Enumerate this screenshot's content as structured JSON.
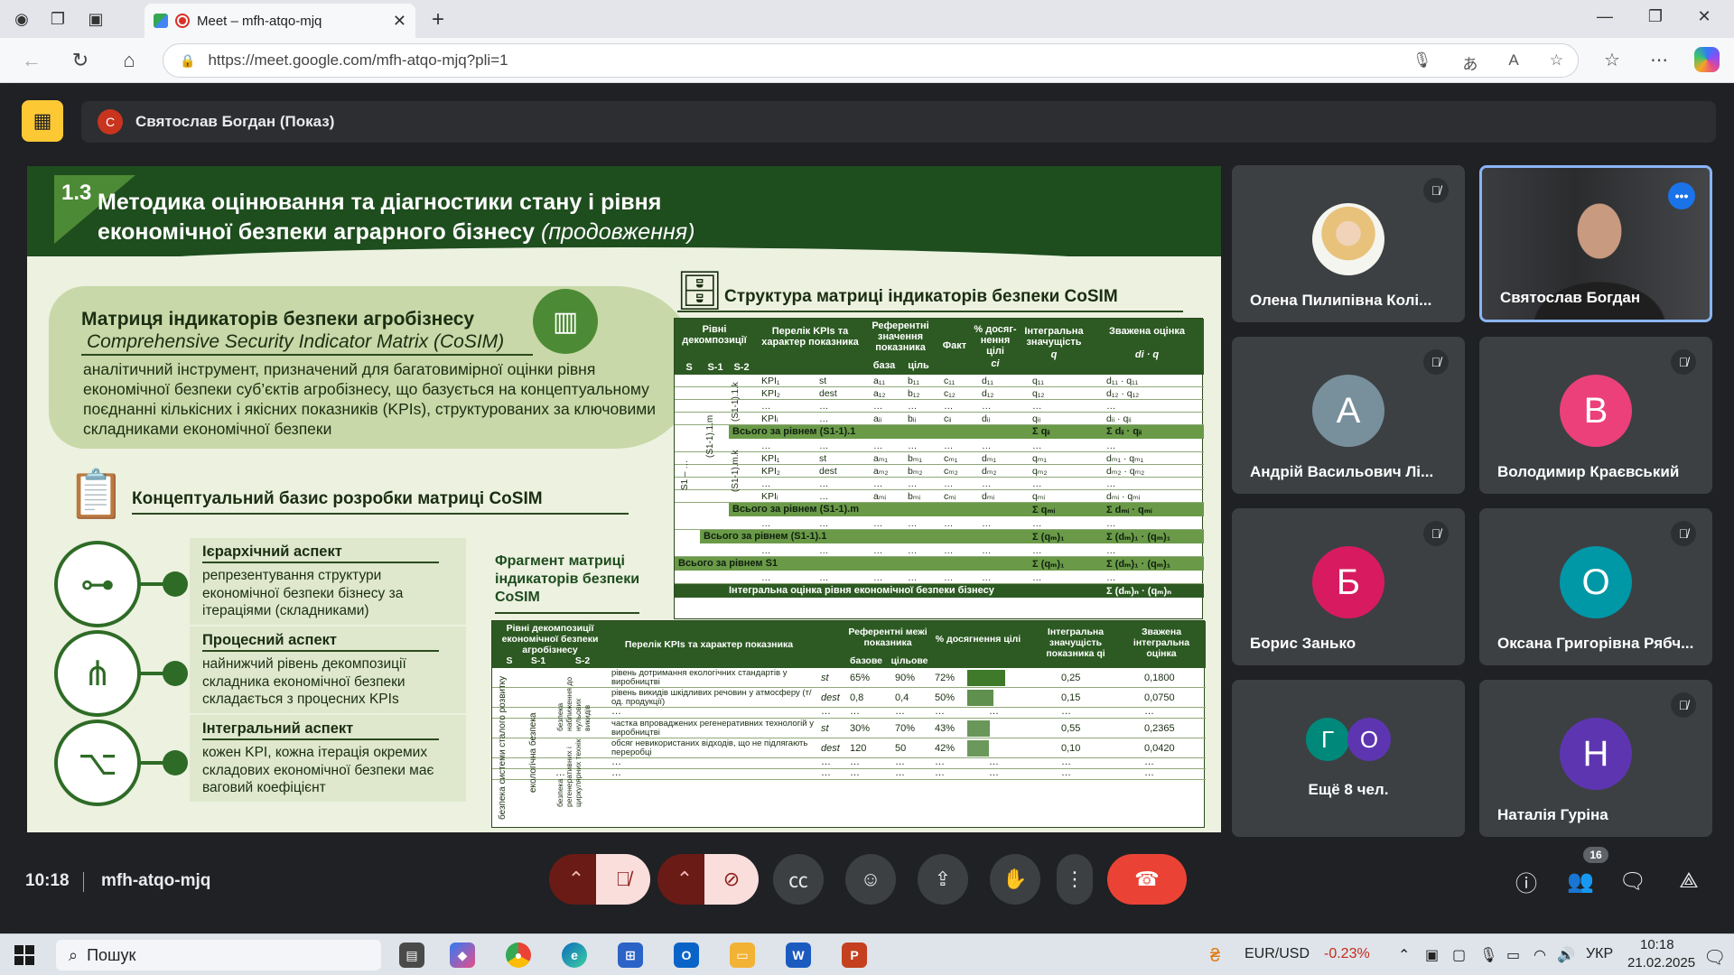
{
  "browser": {
    "tab_title": "Meet – mfh-atqo-mjq",
    "url": "https://meet.google.com/mfh-atqo-mjq?pli=1"
  },
  "meet": {
    "presenter_initial": "С",
    "presenter_label": "Святослав Богдан (Показ)",
    "time": "10:18",
    "code": "mfh-atqo-mjq",
    "participant_count": "16"
  },
  "slide": {
    "num": "1.3",
    "title_main": "Методика оцінювання та діагностики стану і рівня економічної безпеки аграрного бізнесу",
    "title_suffix": "(продовження)",
    "def_title": "Матриця індикаторів безпеки агробізнесу",
    "def_subtitle": "Comprehensive Security Indicator Matrix (CoSIM)",
    "def_body": "аналітичний інструмент, призначений для багатовимірної оцінки рівня економічної безпеки суб’єктів агробізнесу, що базується на концептуальному поєднанні кількісних і якісних показників (KPIs), структурованих за ключовими складниками економічної безпеки",
    "cb_title": "Концептуальний базис розробки матриці CoSIM",
    "aspects": [
      {
        "title": "Ієрархічний аспект",
        "body": "репрезентування структури економічної безпеки бізнесу за ітераціями (складниками)"
      },
      {
        "title": "Процесний аспект",
        "body": "найнижчий рівень декомпозиції складника економічної безпеки складається з процесних KPIs"
      },
      {
        "title": "Інтегральний аспект",
        "body": "кожен KPI, кожна ітерація окремих складових економічної безпеки має ваговий коефіцієнт"
      }
    ],
    "frag_title": "Фрагмент матриці індикаторів безпеки CoSIM",
    "str_title": "Структура матриці індикаторів безпеки CoSIM",
    "mtx": {
      "h_levels": "Рівні декомпозиції",
      "h_s": "S",
      "h_s1": "S-1",
      "h_s2": "S-2",
      "h_kpi": "Перелік KPIs та характер показника",
      "h_ref": "Референтні значення показника",
      "h_base": "база",
      "h_target": "ціль",
      "h_fact": "Факт",
      "h_pct": "% досяг-нення цілі",
      "h_pct_sym": "ci",
      "h_int": "Інтегральна значущість",
      "h_int_sym": "q",
      "h_wgt": "Зважена оцінка",
      "h_wgt_sym": "di · q",
      "rows1": [
        [
          "KPI₁",
          "st",
          "a₁₁",
          "b₁₁",
          "c₁₁",
          "d₁₁",
          "q₁₁",
          "d₁₁ · q₁₁"
        ],
        [
          "KPI₂",
          "dest",
          "a₁₂",
          "b₁₂",
          "c₁₂",
          "d₁₂",
          "q₁₂",
          "d₁₂ · q₁₂"
        ],
        [
          "…",
          "…",
          "…",
          "…",
          "…",
          "…",
          "…",
          "…"
        ],
        [
          "KPIᵢ",
          "…",
          "aᵢᵢ",
          "bᵢᵢ",
          "cᵢᵢ",
          "dᵢᵢ",
          "qᵢᵢ",
          "dᵢᵢ · qᵢᵢ"
        ]
      ],
      "sum1": [
        "Всього за рівнем (S1-1).1",
        "Σ qᵢᵢ",
        "Σ dᵢᵢ · qᵢᵢ"
      ],
      "rows2": [
        [
          "KPI₁",
          "st",
          "aₘ₁",
          "bₘ₁",
          "cₘ₁",
          "dₘ₁",
          "qₘ₁",
          "dₘ₁ · qₘ₁"
        ],
        [
          "KPI₂",
          "dest",
          "aₘ₂",
          "bₘ₂",
          "cₘ₂",
          "dₘ₂",
          "qₘ₂",
          "dₘ₂ · qₘ₂"
        ],
        [
          "…",
          "…",
          "…",
          "…",
          "…",
          "…",
          "…",
          "…"
        ],
        [
          "KPIᵢ",
          "…",
          "aₘᵢ",
          "bₘᵢ",
          "cₘᵢ",
          "dₘᵢ",
          "qₘᵢ",
          "dₘᵢ · qₘᵢ"
        ]
      ],
      "sum2": [
        "Всього за рівнем (S1-1).m",
        "Σ qₘᵢ",
        "Σ dₘᵢ · qₘᵢ"
      ],
      "sum3": [
        "Всього за рівнем (S1-1).1",
        "Σ (qₘ)₁",
        "Σ (dₘ)₁ · (qₘ)₁"
      ],
      "sum4": [
        "Всього за рівнем S1",
        "Σ (qₘ)₁",
        "Σ (dₘ)₁ · (qₘ)₁"
      ],
      "sum5": [
        "Інтегральна оцінка рівня економічної безпеки бізнесу",
        "Σ (dₘ)ₙ · (qₘ)ₙ"
      ],
      "vert_s": "S1 – …",
      "vert_a": "(S1-1).1.k",
      "vert_b": "(S1-1).m.k",
      "vert_c": "(S1-1).1.m",
      "dots": "…"
    },
    "frag": {
      "h_levels": "Рівні декомпозиції економічної безпеки агробізнесу",
      "h_s": "S",
      "h_s1": "S-1",
      "h_s2": "S-2",
      "h_kpi": "Перелік KPIs та характер показника",
      "h_ref": "Референтні межі показника",
      "h_base": "базове",
      "h_target": "цільове",
      "h_pct": "% досягнення цілі",
      "h_int": "Інтегральна значущість показника qi",
      "h_wgt": "Зважена інтегральна оцінка",
      "vert_s": "безпека системи сталого розвитку",
      "vert_s1": "екологічна безпека",
      "vert_a": "безпека наближення до нульових викидів",
      "vert_b": "безпека регенеративних і циркулярних технік",
      "rows": [
        {
          "kpi": "рівень дотримання екологічних стандартів у виробництві",
          "type": "st",
          "base": "65%",
          "target": "90%",
          "pct": "72%",
          "pct_val": 72,
          "q": "0,25",
          "w": "0,1800"
        },
        {
          "kpi": "рівень викидів шкідливих речовин у атмосферу (т/од. продукції)",
          "type": "dest",
          "base": "0,8",
          "target": "0,4",
          "pct": "50%",
          "pct_val": 50,
          "q": "0,15",
          "w": "0,0750"
        },
        {
          "kpi": "частка впроваджених регенеративних технологій у виробництві",
          "type": "st",
          "base": "30%",
          "target": "70%",
          "pct": "43%",
          "pct_val": 43,
          "q": "0,55",
          "w": "0,2365"
        },
        {
          "kpi": "обсяг невикористаних відходів, що не підлягають переробці",
          "type": "dest",
          "base": "120",
          "target": "50",
          "pct": "42%",
          "pct_val": 42,
          "q": "0,10",
          "w": "0,0420"
        }
      ],
      "dots": "…"
    }
  },
  "participants": [
    {
      "name": "Олена Пилипівна Колі...",
      "kind": "photo"
    },
    {
      "name": "Святослав Богдан",
      "kind": "video"
    },
    {
      "name": "Андрій Васильович Лі...",
      "initial": "А",
      "color": "#78909c"
    },
    {
      "name": "Володимир Краєвський",
      "initial": "В",
      "color": "#ec407a"
    },
    {
      "name": "Борис Занько",
      "initial": "Б",
      "color": "#d81b60"
    },
    {
      "name": "Оксана Григорівна Рябч...",
      "initial": "О",
      "color": "#0097a7"
    },
    {
      "name": "Ещё 8 чел.",
      "initial": "Г",
      "initial2": "О"
    },
    {
      "name": "Наталія Гуріна",
      "initial": "Н",
      "color": "#5e35b1"
    }
  ],
  "taskbar": {
    "search": "Пошук",
    "ticker": "EUR/USD",
    "ticker_change": "-0.23%",
    "lang": "УКР",
    "time": "10:18",
    "date": "21.02.2025"
  }
}
